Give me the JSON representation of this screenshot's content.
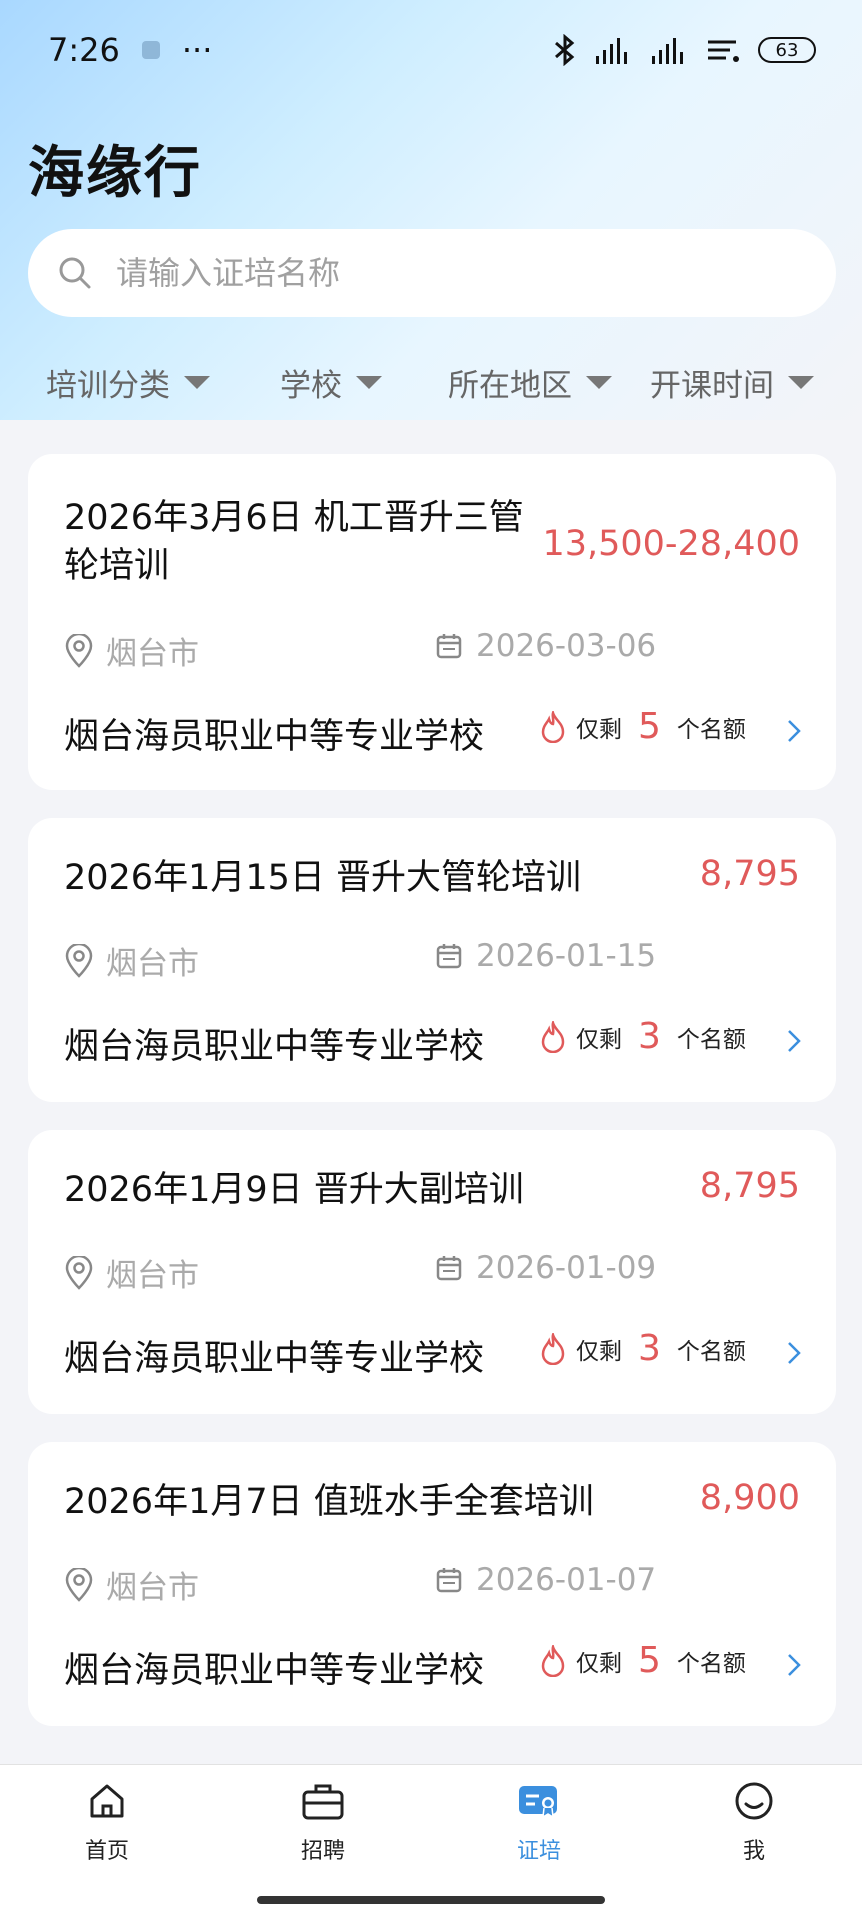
{
  "status_bar": {
    "time": "7:26",
    "dots": "···",
    "battery": "63"
  },
  "app_title": "海缘行",
  "search": {
    "placeholder": "请输入证培名称"
  },
  "filters": [
    "培训分类",
    "学校",
    "所在地区",
    "开课时间"
  ],
  "courses": [
    {
      "title": "2026年3月6日 机工晋升三管轮培训",
      "price": "13,500-28,400",
      "location": "烟台市",
      "date": "2026-03-06",
      "school": "烟台海员职业中等专业学校",
      "quota_prefix": "仅剩",
      "quota": "5",
      "quota_suffix": "个名额"
    },
    {
      "title": "2026年1月15日 晋升大管轮培训",
      "price": "8,795",
      "location": "烟台市",
      "date": "2026-01-15",
      "school": "烟台海员职业中等专业学校",
      "quota_prefix": "仅剩",
      "quota": "3",
      "quota_suffix": "个名额"
    },
    {
      "title": "2026年1月9日 晋升大副培训",
      "price": "8,795",
      "location": "烟台市",
      "date": "2026-01-09",
      "school": "烟台海员职业中等专业学校",
      "quota_prefix": "仅剩",
      "quota": "3",
      "quota_suffix": "个名额"
    },
    {
      "title": "2026年1月7日 值班水手全套培训",
      "price": "8,900",
      "location": "烟台市",
      "date": "2026-01-07",
      "school": "烟台海员职业中等专业学校",
      "quota_prefix": "仅剩",
      "quota": "5",
      "quota_suffix": "个名额"
    }
  ],
  "tabs": [
    {
      "label": "首页",
      "icon": "home-icon"
    },
    {
      "label": "招聘",
      "icon": "briefcase-icon"
    },
    {
      "label": "证培",
      "icon": "certificate-icon",
      "active": true
    },
    {
      "label": "我",
      "icon": "smiley-icon"
    }
  ],
  "colors": {
    "accent": "#3b8fde",
    "price": "#e05a5a"
  }
}
